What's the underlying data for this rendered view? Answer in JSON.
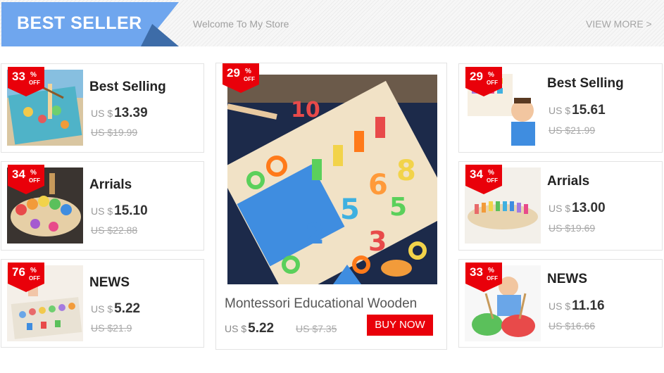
{
  "header": {
    "banner_title": "BEST SELLER",
    "welcome": "Welcome To My Store",
    "view_more": "VIEW MORE >"
  },
  "colors": {
    "banner": "#6fa6ee",
    "banner_fold": "#3d6ca8",
    "badge": "#e9000a",
    "buy_button": "#e9000a"
  },
  "left_products": [
    {
      "discount": "33",
      "pct": "%",
      "off": "OFF",
      "title": "Best Selling",
      "currency": "US $",
      "price": "13.39",
      "old_price": "US $19.99",
      "image_icon": "fishing-puzzle-image"
    },
    {
      "discount": "34",
      "pct": "%",
      "off": "OFF",
      "title": "Arrials",
      "currency": "US $",
      "price": "15.10",
      "old_price": "US $22.88",
      "image_icon": "stacking-rings-image"
    },
    {
      "discount": "76",
      "pct": "%",
      "off": "OFF",
      "title": "NEWS",
      "currency": "US $",
      "price": "5.22",
      "old_price": "US $21.9",
      "image_icon": "number-board-image"
    }
  ],
  "right_products": [
    {
      "discount": "29",
      "pct": "%",
      "off": "OFF",
      "title": "Best Selling",
      "currency": "US $",
      "price": "15.61",
      "old_price": "US $21.99",
      "image_icon": "alphabet-board-kid-image"
    },
    {
      "discount": "34",
      "pct": "%",
      "off": "OFF",
      "title": "Arrials",
      "currency": "US $",
      "price": "13.00",
      "old_price": "US $19.69",
      "image_icon": "color-pegs-image"
    },
    {
      "discount": "33",
      "pct": "%",
      "off": "OFF",
      "title": "NEWS",
      "currency": "US $",
      "price": "11.16",
      "old_price": "US $16.66",
      "image_icon": "kid-fishing-game-image"
    }
  ],
  "featured": {
    "discount": "29",
    "pct": "%",
    "off": "OFF",
    "title": "Montessori Educational Wooden",
    "currency": "US $",
    "price": "5.22",
    "old_price": "US $7.35",
    "buy_label": "BUY NOW",
    "image_icon": "montessori-board-image"
  }
}
